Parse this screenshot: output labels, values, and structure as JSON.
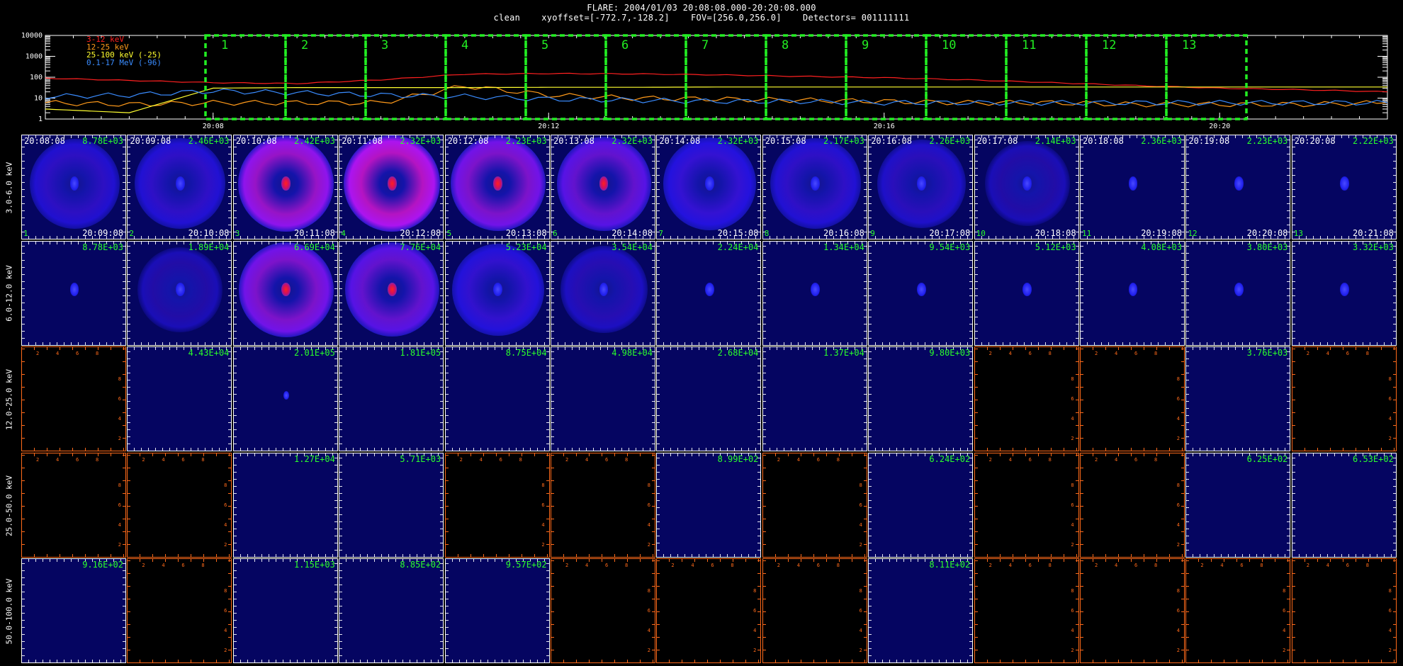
{
  "header": {
    "line1": "FLARE: 2004/01/03 20:08:08.000-20:20:08.000",
    "line2": "clean    xyoffset=[-772.7,-128.2]    FOV=[256.0,256.0]    Detectors= 001111111"
  },
  "chart_data": [
    {
      "type": "line",
      "y_scale": "log",
      "ylim": [
        1,
        10000
      ],
      "y_ticks": [
        "10000",
        "1000",
        "100",
        "10",
        "1"
      ],
      "x_range": [
        "20:06:00",
        "20:22:00"
      ],
      "x_ticks": [
        "20:08",
        "20:12",
        "20:16",
        "20:20"
      ],
      "series": [
        {
          "name": "3-12 keV",
          "color": "#ff2020",
          "x": [
            "20:06",
            "20:07",
            "20:08",
            "20:09",
            "20:10",
            "20:11",
            "20:12",
            "20:13",
            "20:14",
            "20:15",
            "20:16",
            "20:17",
            "20:18",
            "20:19",
            "20:20",
            "20:21",
            "20:22"
          ],
          "values": [
            90,
            70,
            55,
            50,
            75,
            140,
            150,
            145,
            130,
            110,
            95,
            75,
            55,
            40,
            30,
            25,
            20
          ]
        },
        {
          "name": "12-25 keV",
          "color": "#ff9a1a",
          "x": [
            "20:06",
            "20:07",
            "20:08",
            "20:09",
            "20:10",
            "20:11",
            "20:12",
            "20:13",
            "20:14",
            "20:15",
            "20:16",
            "20:17",
            "20:18",
            "20:19",
            "20:20",
            "20:21",
            "20:22"
          ],
          "values": [
            6,
            5,
            6,
            6,
            6,
            38,
            14,
            10,
            9,
            8,
            7,
            6,
            6,
            5,
            5,
            5,
            6
          ]
        },
        {
          "name": "25-100 keV (-25)",
          "color": "#ffff30",
          "x": [
            "20:06",
            "20:07",
            "20:08",
            "20:09",
            "20:10",
            "20:11",
            "20:12",
            "20:13",
            "20:14",
            "20:15",
            "20:16",
            "20:17",
            "20:18",
            "20:19",
            "20:20",
            "20:21",
            "20:22"
          ],
          "values": [
            3,
            2,
            30,
            32,
            32,
            32,
            33,
            33,
            34,
            34,
            34,
            34,
            34,
            34,
            34,
            34,
            34
          ]
        },
        {
          "name": "0.1-17 MeV (-96)",
          "color": "#3a8cff",
          "x": [
            "20:06",
            "20:07",
            "20:08",
            "20:09",
            "20:10",
            "20:11",
            "20:12",
            "20:13",
            "20:14",
            "20:15",
            "20:16",
            "20:17",
            "20:18",
            "20:19",
            "20:20",
            "20:21",
            "20:22"
          ],
          "values": [
            12,
            14,
            22,
            18,
            14,
            12,
            9,
            8,
            7,
            7,
            6,
            6,
            6,
            6,
            6,
            6,
            6
          ]
        }
      ],
      "intervals": [
        "1",
        "2",
        "3",
        "4",
        "5",
        "6",
        "7",
        "8",
        "9",
        "10",
        "11",
        "12",
        "13"
      ]
    },
    {
      "type": "heatmap",
      "energy_bands": [
        "3.0-6.0 keV",
        "6.0-12.0 keV",
        "12.0-25.0 keV",
        "25.0-50.0 keV",
        "50.0-100.0 keV"
      ],
      "start_times": [
        "20:08:08",
        "20:09:08",
        "20:10:08",
        "20:11:08",
        "20:12:08",
        "20:13:08",
        "20:14:08",
        "20:15:08",
        "20:16:08",
        "20:17:08",
        "20:18:08",
        "20:19:08",
        "20:20:08"
      ],
      "end_times": [
        "20:09:08",
        "20:10:08",
        "20:11:08",
        "20:12:08",
        "20:13:08",
        "20:14:08",
        "20:15:08",
        "20:16:08",
        "20:17:08",
        "20:18:08",
        "20:19:08",
        "20:20:08",
        "20:21:08"
      ],
      "interval_numbers": [
        "1",
        "2",
        "3",
        "4",
        "5",
        "6",
        "7",
        "8",
        "9",
        "10",
        "11",
        "12",
        "13"
      ],
      "peaks": [
        [
          "8.78E+03",
          "2.46E+03",
          "2.42E+03",
          "2.32E+03",
          "2.23E+03",
          "2.32E+03",
          "2.32E+03",
          "2.17E+03",
          "2.26E+03",
          "2.14E+03",
          "2.36E+03",
          "2.23E+03",
          "2.22E+03"
        ],
        [
          "8.78E+03",
          "1.89E+04",
          "6.69E+04",
          "7.76E+04",
          "5.23E+04",
          "3.54E+04",
          "2.24E+04",
          "1.34E+04",
          "9.54E+03",
          "5.12E+03",
          "4.08E+03",
          "3.80E+03",
          "3.32E+03"
        ],
        [
          null,
          "4.43E+04",
          "2.01E+05",
          "1.81E+05",
          "8.75E+04",
          "4.98E+04",
          "2.68E+04",
          "1.37E+04",
          "9.80E+03",
          null,
          null,
          "3.76E+03",
          null
        ],
        [
          null,
          null,
          "1.27E+04",
          "5.71E+03",
          null,
          null,
          "8.99E+02",
          null,
          "6.24E+02",
          null,
          null,
          "6.25E+02",
          "6.53E+02"
        ],
        [
          "9.16E+02",
          null,
          "1.15E+03",
          "8.85E+02",
          "9.57E+02",
          null,
          null,
          null,
          "8.11E+02",
          null,
          null,
          null,
          null
        ]
      ],
      "axis_numbers": [
        "2",
        "4",
        "6",
        "8"
      ]
    }
  ]
}
